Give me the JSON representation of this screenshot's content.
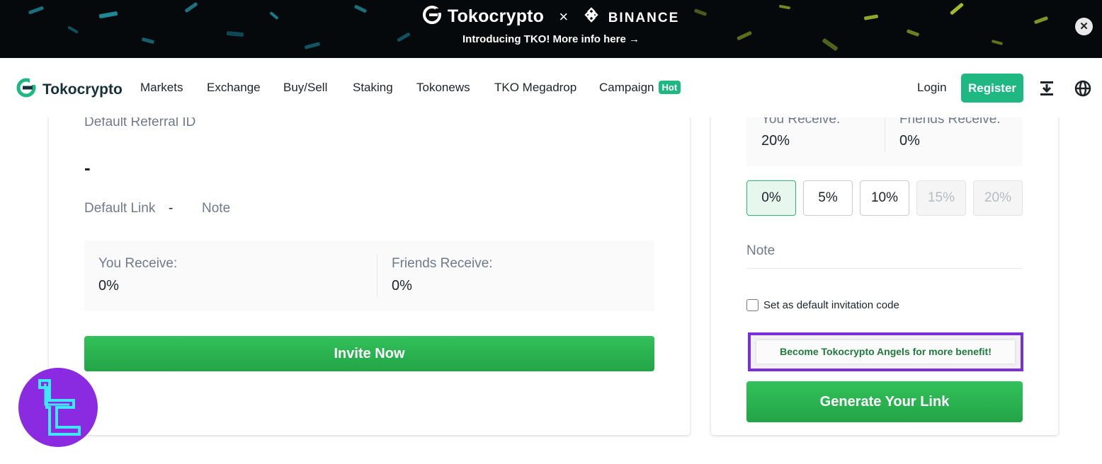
{
  "banner": {
    "brand": "Tokocrypto",
    "times": "×",
    "partner": "BINANCE",
    "subtitle": "Introducing TKO! More info here →",
    "close_glyph": "✕"
  },
  "nav": {
    "logo_text": "Tokocrypto",
    "items": [
      {
        "label": "Markets"
      },
      {
        "label": "Exchange"
      },
      {
        "label": "Buy/Sell"
      },
      {
        "label": "Staking"
      },
      {
        "label": "Tokonews"
      },
      {
        "label": "TKO Megadrop"
      },
      {
        "label": "Campaign"
      }
    ],
    "hot_badge": "Hot",
    "login": "Login",
    "register": "Register",
    "icons": [
      "download-icon",
      "globe-icon"
    ]
  },
  "left_card": {
    "default_referral_id_label": "Default Referral ID",
    "default_referral_id_value": "-",
    "default_link_label": "Default Link",
    "default_link_value": "-",
    "note_label": "Note",
    "you_receive_label": "You Receive:",
    "you_receive_value": "0%",
    "friends_receive_label": "Friends Receive:",
    "friends_receive_value": "0%",
    "invite_button": "Invite Now"
  },
  "right_card": {
    "you_receive_label": "You Receive:",
    "you_receive_value": "20%",
    "friends_receive_label": "Friends Receive:",
    "friends_receive_value": "0%",
    "percent_options": [
      {
        "label": "0%",
        "state": "selected"
      },
      {
        "label": "5%",
        "state": "enabled"
      },
      {
        "label": "10%",
        "state": "enabled"
      },
      {
        "label": "15%",
        "state": "disabled"
      },
      {
        "label": "20%",
        "state": "disabled"
      }
    ],
    "note_placeholder": "Note",
    "default_checkbox_label": "Set as default invitation code",
    "default_checkbox_checked": false,
    "angels_banner": "Become Tokocrypto Angels for more benefit!",
    "generate_button": "Generate Your Link"
  },
  "colors": {
    "brand_green": "#1fb883",
    "button_green": "#27ae4f",
    "highlight_purple": "#7b2fd9",
    "watermark_purple": "#8a2be2",
    "watermark_cyan": "#3ee6ff"
  }
}
